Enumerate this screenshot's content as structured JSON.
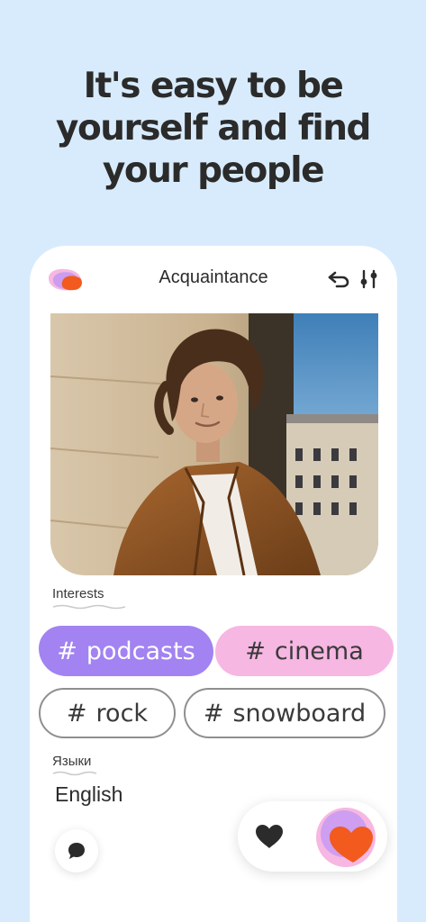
{
  "headline": {
    "line1": "It's easy to be",
    "line2": "yourself and find",
    "line3": "your people"
  },
  "app": {
    "title": "Acquaintance",
    "logo_icon": "app-logo-icon",
    "undo_icon": "undo-arrow-icon",
    "filter_icon": "filter-sliders-icon"
  },
  "profile": {
    "photo": "profile-photo",
    "interests_label": "Interests",
    "interests": [
      {
        "hash": "#",
        "name": "podcasts"
      },
      {
        "hash": "#",
        "name": "cinema"
      },
      {
        "hash": "#",
        "name": "rock"
      },
      {
        "hash": "#",
        "name": "snowboard"
      }
    ],
    "languages_label": "Языки",
    "language": "English"
  },
  "actions": {
    "chat_icon": "chat-bubble-icon",
    "like_icon": "heart-icon",
    "superlike_icon": "super-like-icon"
  },
  "colors": {
    "background": "#d8ebfc",
    "purple": "#a283f1",
    "pink": "#f6b7e2",
    "orange": "#f25a1e"
  }
}
